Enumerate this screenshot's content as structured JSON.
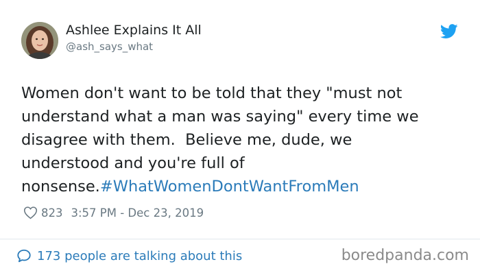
{
  "user": {
    "display_name": "Ashlee Explains It All",
    "handle": "@ash_says_what"
  },
  "tweet": {
    "text": "Women don't want to be told that they \"must not\nunderstand what a man was saying\" every time we\ndisagree with them.  Believe me, dude, we\nunderstood and you're full of\nnonsense.",
    "hashtag": "#WhatWomenDontWantFromMen"
  },
  "meta": {
    "likes": "823",
    "timestamp": "3:57 PM - Dec 23, 2019"
  },
  "footer": {
    "talking": "173 people are talking about this",
    "watermark": "boredpanda.com"
  },
  "icons": {
    "brand": "twitter-bird-icon",
    "like": "heart-icon",
    "reply": "speech-bubble-icon"
  },
  "colors": {
    "twitter_blue": "#1da1f2",
    "link_blue": "#2b7bb9",
    "muted_gray": "#697882",
    "text_dark": "#1c2022"
  }
}
